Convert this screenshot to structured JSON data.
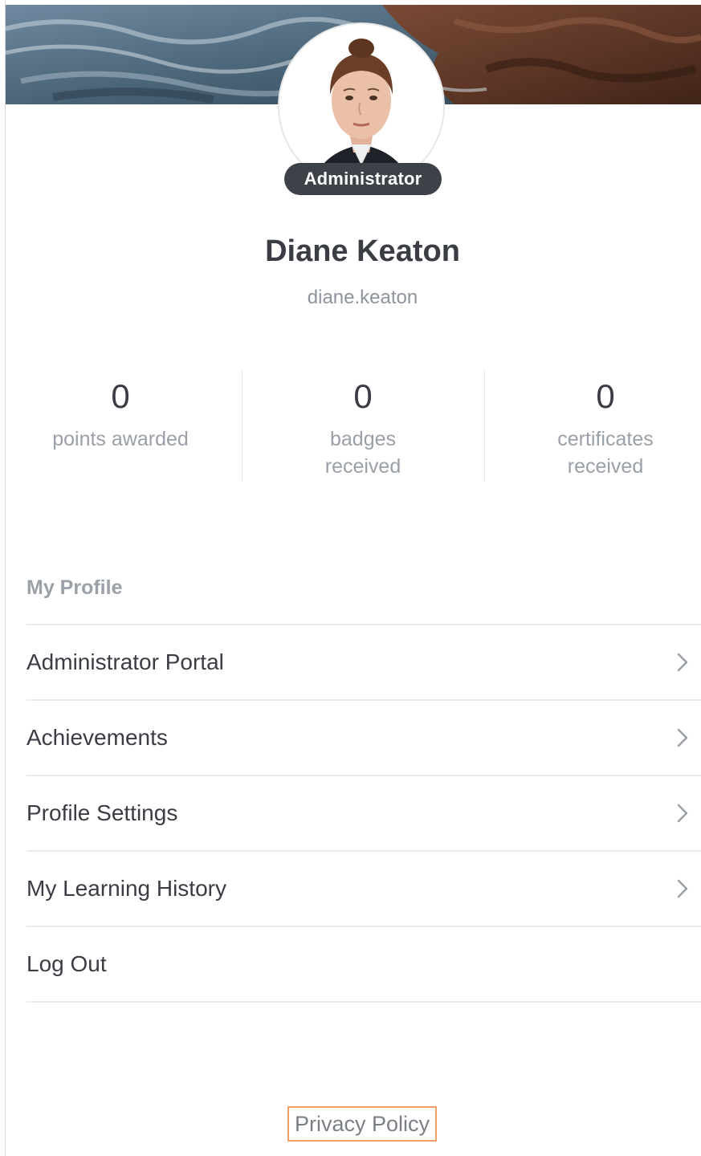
{
  "profile": {
    "role_badge": "Administrator",
    "name": "Diane Keaton",
    "username": "diane.keaton"
  },
  "stats": [
    {
      "value": "0",
      "label": "points awarded"
    },
    {
      "value": "0",
      "label": "badges received"
    },
    {
      "value": "0",
      "label": "certificates received"
    }
  ],
  "menu": {
    "section_title": "My Profile",
    "items": [
      {
        "label": "Administrator Portal",
        "icon": "chevron-right-icon"
      },
      {
        "label": "Achievements",
        "icon": "chevron-right-icon"
      },
      {
        "label": "Profile Settings",
        "icon": "chevron-right-icon"
      },
      {
        "label": "My Learning History",
        "icon": "chevron-right-icon"
      },
      {
        "label": "Log Out"
      }
    ]
  },
  "footer": {
    "privacy_link": "Privacy Policy"
  },
  "colors": {
    "badge_bg": "#3d4148",
    "text_primary": "#3a3d44",
    "text_muted": "#9aa0a7",
    "focus_outline": "#f0a064"
  }
}
